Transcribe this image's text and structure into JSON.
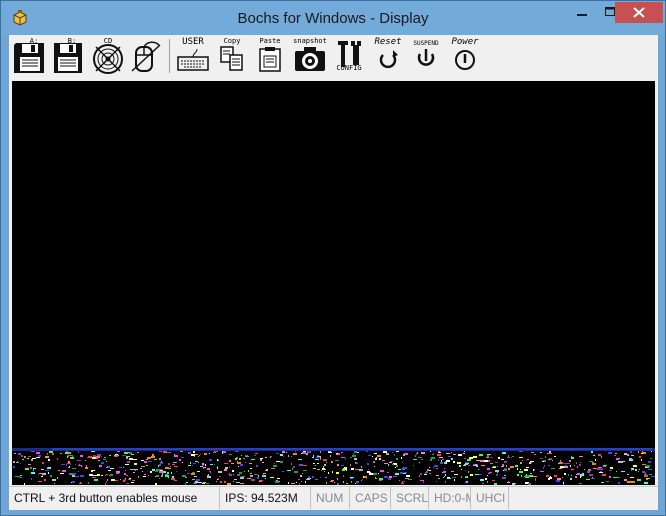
{
  "window": {
    "title": "Bochs for Windows - Display"
  },
  "toolbar": {
    "floppy_a": "A:",
    "floppy_b": "B:",
    "cdrom": "CD",
    "user": "USER",
    "copy": "Copy",
    "paste": "Paste",
    "snapshot": "snapshot",
    "config": "CONFIG",
    "reset": "Reset",
    "suspend": "SUSPEND",
    "power": "Power"
  },
  "status": {
    "message": "CTRL + 3rd button enables mouse",
    "ips": "IPS: 94.523M",
    "num": "NUM",
    "caps": "CAPS",
    "scrl": "SCRL",
    "hd": "HD:0-M",
    "uhci": "UHCI"
  },
  "colors": {
    "titlebar": "#72aada",
    "close": "#c75050",
    "screen": "#000000"
  }
}
